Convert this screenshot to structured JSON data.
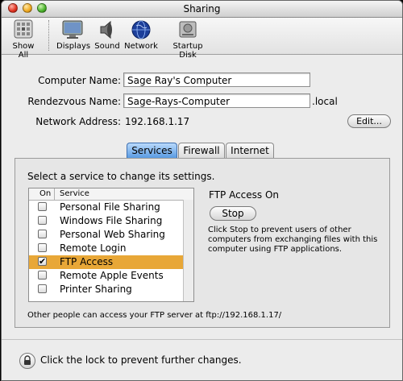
{
  "window": {
    "title": "Sharing"
  },
  "toolbar": {
    "items": [
      {
        "label": "Show All",
        "icon": "show-all-icon"
      },
      {
        "label": "Displays",
        "icon": "displays-icon"
      },
      {
        "label": "Sound",
        "icon": "speaker-icon"
      },
      {
        "label": "Network",
        "icon": "globe-icon"
      },
      {
        "label": "Startup Disk",
        "icon": "hard-disk-icon"
      }
    ]
  },
  "identity": {
    "computer_name_label": "Computer Name:",
    "computer_name_value": "Sage Ray's Computer",
    "rendezvous_label": "Rendezvous Name:",
    "rendezvous_value": "Sage-Rays-Computer",
    "rendezvous_suffix": ".local",
    "network_address_label": "Network Address:",
    "network_address_value": "192.168.1.17",
    "edit_button": "Edit..."
  },
  "tabs": [
    {
      "label": "Services",
      "active": true
    },
    {
      "label": "Firewall",
      "active": false
    },
    {
      "label": "Internet",
      "active": false
    }
  ],
  "services": {
    "prompt": "Select a service to change its settings.",
    "column_on": "On",
    "column_service": "Service",
    "items": [
      {
        "label": "Personal File Sharing",
        "checked": false,
        "selected": false
      },
      {
        "label": "Windows File Sharing",
        "checked": false,
        "selected": false
      },
      {
        "label": "Personal Web Sharing",
        "checked": false,
        "selected": false
      },
      {
        "label": "Remote Login",
        "checked": false,
        "selected": false
      },
      {
        "label": "FTP Access",
        "checked": true,
        "selected": true
      },
      {
        "label": "Remote Apple Events",
        "checked": false,
        "selected": false
      },
      {
        "label": "Printer Sharing",
        "checked": false,
        "selected": false
      }
    ],
    "status_title": "FTP Access On",
    "stop_button": "Stop",
    "stop_description": "Click Stop to prevent users of other computers from exchanging files with this computer using FTP applications.",
    "footer_note": "Other people can access your FTP server at ftp://192.168.1.17/"
  },
  "lock": {
    "text": "Click the lock to prevent further changes.",
    "icon": "lock-icon"
  },
  "colors": {
    "selection": "#e8a737",
    "tab_active": "#5a9be2"
  }
}
